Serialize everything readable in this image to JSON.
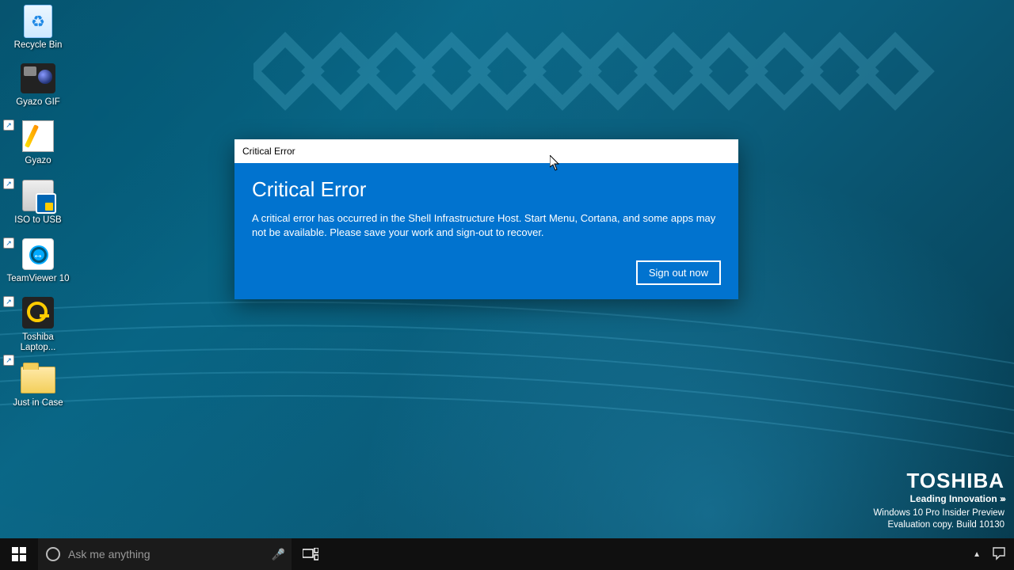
{
  "desktop": {
    "icons": [
      {
        "label": "Recycle Bin"
      },
      {
        "label": "Gyazo GIF"
      },
      {
        "label": "Gyazo"
      },
      {
        "label": "ISO to USB"
      },
      {
        "label": "TeamViewer 10"
      },
      {
        "label": "Toshiba Laptop..."
      },
      {
        "label": "Just in Case"
      }
    ]
  },
  "dialog": {
    "titlebar": "Critical Error",
    "heading": "Critical Error",
    "body": "A critical error has occurred in the Shell Infrastructure Host. Start Menu, Cortana, and some apps may not be available.  Please save your work and sign-out to recover.",
    "button": "Sign out now"
  },
  "watermark": {
    "brand": "TOSHIBA",
    "tagline": "Leading Innovation",
    "line1": "Windows 10 Pro Insider Preview",
    "line2": "Evaluation copy. Build 10130"
  },
  "taskbar": {
    "search_placeholder": "Ask me anything"
  }
}
